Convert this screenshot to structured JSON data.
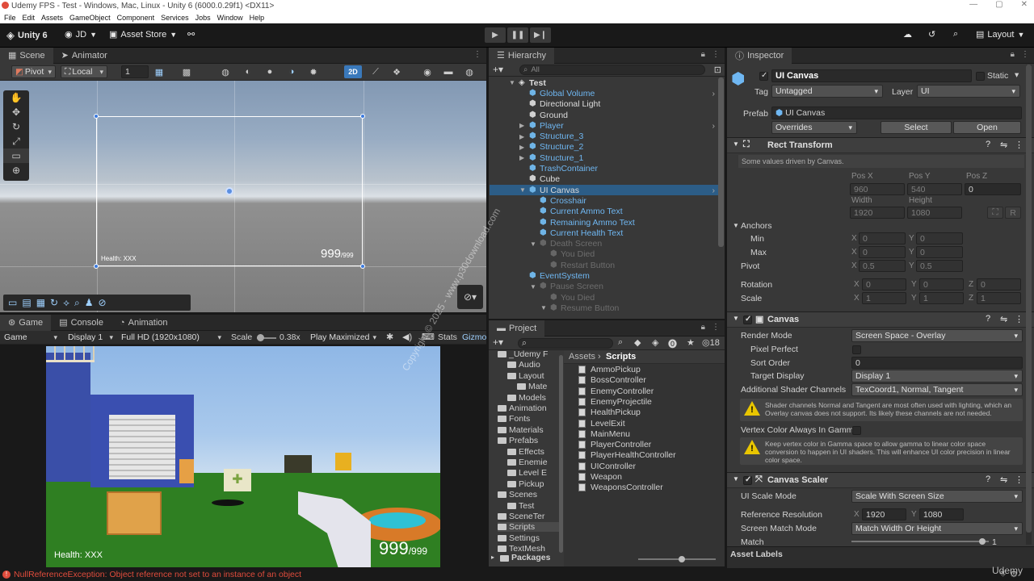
{
  "window": {
    "title": "Udemy FPS - Test - Windows, Mac, Linux - Unity 6 (6000.0.29f1) <DX11>"
  },
  "menu": [
    "File",
    "Edit",
    "Assets",
    "GameObject",
    "Component",
    "Services",
    "Jobs",
    "Window",
    "Help"
  ],
  "toolbar": {
    "unity_label": "Unity 6",
    "account": "JD",
    "asset_store": "Asset Store",
    "layout": "Layout"
  },
  "scene": {
    "tabs": [
      "Scene",
      "Animator"
    ],
    "pivot": "Pivot",
    "local": "Local",
    "snap": "1",
    "mode2d": "2D",
    "canvas_health": "Health: XXX",
    "canvas_ammo_big": "999",
    "canvas_ammo_small": "/999"
  },
  "game": {
    "tabs": [
      "Game",
      "Console",
      "Animation"
    ],
    "game_dd": "Game",
    "display": "Display 1",
    "resolution": "Full HD (1920x1080)",
    "scale_label": "Scale",
    "scale_value": "0.38x",
    "play_mode": "Play Maximized",
    "stats": "Stats",
    "gizmos": "Gizmos",
    "health": "Health: XXX",
    "ammo_big": "999",
    "ammo_small": "/999"
  },
  "hierarchy": {
    "tab": "Hierarchy",
    "search_placeholder": "All",
    "items": [
      {
        "label": "Test",
        "indent": 0,
        "style": "white",
        "bold": true
      },
      {
        "label": "Global Volume",
        "indent": 1,
        "style": "blue"
      },
      {
        "label": "Directional Light",
        "indent": 1,
        "style": "white"
      },
      {
        "label": "Ground",
        "indent": 1,
        "style": "white"
      },
      {
        "label": "Player",
        "indent": 1,
        "style": "blue"
      },
      {
        "label": "Structure_3",
        "indent": 1,
        "style": "blue"
      },
      {
        "label": "Structure_2",
        "indent": 1,
        "style": "blue"
      },
      {
        "label": "Structure_1",
        "indent": 1,
        "style": "blue"
      },
      {
        "label": "TrashContainer",
        "indent": 1,
        "style": "blue"
      },
      {
        "label": "Cube",
        "indent": 1,
        "style": "white"
      },
      {
        "label": "UI Canvas",
        "indent": 1,
        "style": "selected"
      },
      {
        "label": "Crosshair",
        "indent": 2,
        "style": "blue"
      },
      {
        "label": "Current Ammo Text",
        "indent": 2,
        "style": "blue"
      },
      {
        "label": "Remaining Ammo Text",
        "indent": 2,
        "style": "blue"
      },
      {
        "label": "Current Health Text",
        "indent": 2,
        "style": "blue"
      },
      {
        "label": "Death Screen",
        "indent": 2,
        "style": "dim"
      },
      {
        "label": "You Died",
        "indent": 3,
        "style": "dim"
      },
      {
        "label": "Restart Button",
        "indent": 3,
        "style": "dim"
      },
      {
        "label": "EventSystem",
        "indent": 1,
        "style": "blue"
      },
      {
        "label": "Pause Screen",
        "indent": 2,
        "style": "dim"
      },
      {
        "label": "You Died",
        "indent": 3,
        "style": "dim"
      },
      {
        "label": "Resume Button",
        "indent": 3,
        "style": "dim"
      }
    ]
  },
  "project": {
    "tab": "Project",
    "count": "18",
    "breadcrumb_root": "Assets",
    "breadcrumb_leaf": "Scripts",
    "tree": [
      {
        "label": "_Udemy F",
        "indent": 0
      },
      {
        "label": "Audio",
        "indent": 1
      },
      {
        "label": "Layout",
        "indent": 1
      },
      {
        "label": "Mate",
        "indent": 2
      },
      {
        "label": "Models",
        "indent": 1
      },
      {
        "label": "Animation",
        "indent": 0
      },
      {
        "label": "Fonts",
        "indent": 0
      },
      {
        "label": "Materials",
        "indent": 0
      },
      {
        "label": "Prefabs",
        "indent": 0
      },
      {
        "label": "Effects",
        "indent": 1
      },
      {
        "label": "Enemie",
        "indent": 1
      },
      {
        "label": "Level E",
        "indent": 1
      },
      {
        "label": "Pickup",
        "indent": 1
      },
      {
        "label": "Scenes",
        "indent": 0
      },
      {
        "label": "Test",
        "indent": 1
      },
      {
        "label": "SceneTer",
        "indent": 0
      },
      {
        "label": "Scripts",
        "indent": 0
      },
      {
        "label": "Settings",
        "indent": 0
      },
      {
        "label": "TextMesh",
        "indent": 0
      }
    ],
    "packages": "Packages",
    "files": [
      "AmmoPickup",
      "BossController",
      "EnemyController",
      "EnemyProjectile",
      "HealthPickup",
      "LevelExit",
      "MainMenu",
      "PlayerController",
      "PlayerHealthController",
      "UIController",
      "Weapon",
      "WeaponsController"
    ]
  },
  "inspector": {
    "tab": "Inspector",
    "object_name": "UI Canvas",
    "static_label": "Static",
    "tag_label": "Tag",
    "tag_value": "Untagged",
    "layer_label": "Layer",
    "layer_value": "UI",
    "prefab_label": "Prefab",
    "prefab_value": "UI Canvas",
    "overrides": "Overrides",
    "select": "Select",
    "open": "Open",
    "rect": {
      "title": "Rect Transform",
      "note": "Some values driven by Canvas.",
      "posx_label": "Pos X",
      "posy_label": "Pos Y",
      "posz_label": "Pos Z",
      "posx": "960",
      "posy": "540",
      "posz": "0",
      "width_label": "Width",
      "height_label": "Height",
      "width": "1920",
      "height": "1080",
      "r_btn": "R",
      "anchors": "Anchors",
      "min": "Min",
      "max": "Max",
      "min_x": "0",
      "min_y": "0",
      "max_x": "0",
      "max_y": "0",
      "pivot": "Pivot",
      "pivot_x": "0.5",
      "pivot_y": "0.5",
      "rotation": "Rotation",
      "rot_x": "0",
      "rot_y": "0",
      "rot_z": "0",
      "scale": "Scale",
      "scale_x": "1",
      "scale_y": "1",
      "scale_z": "1"
    },
    "canvas": {
      "title": "Canvas",
      "render_mode_label": "Render Mode",
      "render_mode": "Screen Space - Overlay",
      "pixel_perfect": "Pixel Perfect",
      "sort_order_label": "Sort Order",
      "sort_order": "0",
      "target_display_label": "Target Display",
      "target_display": "Display 1",
      "shader_channels_label": "Additional Shader Channels",
      "shader_channels": "TexCoord1, Normal, Tangent",
      "warn1": "Shader channels Normal and Tangent are most often used with lighting, which an Overlay canvas does not support. Its likely these channels are not needed.",
      "vertex_color_label": "Vertex Color Always In Gamm",
      "warn2": "Keep vertex color in Gamma space to allow gamma to linear color space conversion to happen in UI shaders. This will enhance UI color precision in linear color space."
    },
    "scaler": {
      "title": "Canvas Scaler",
      "ui_scale_mode_label": "UI Scale Mode",
      "ui_scale_mode": "Scale With Screen Size",
      "ref_res_label": "Reference Resolution",
      "ref_x": "1920",
      "ref_y": "1080",
      "match_mode_label": "Screen Match Mode",
      "match_mode": "Match Width Or Height",
      "match_label": "Match",
      "match_value": "1"
    },
    "asset_labels": "Asset Labels"
  },
  "watermark": "Copyright © 2025 - www.p30download.com",
  "status": {
    "error": "NullReferenceException: Object reference not set to an instance of an object"
  },
  "udemy_logo": "Udemy",
  "colors": {
    "selection": "#2c5d87",
    "prefab_blue": "#6fb7f2",
    "error_red": "#e04c3c",
    "panel": "#383838",
    "warning": "#e9c600"
  }
}
